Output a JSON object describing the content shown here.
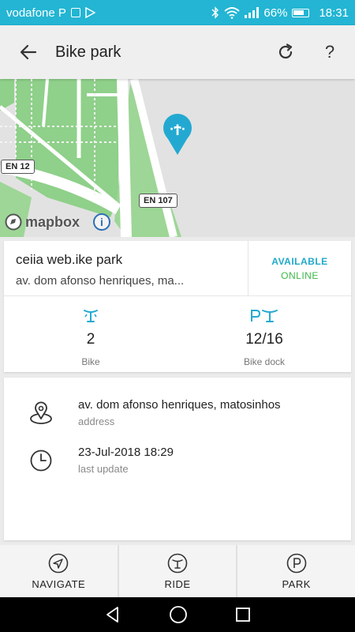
{
  "status_bar": {
    "carrier": "vodafone P",
    "battery": "66%",
    "time": "18:31"
  },
  "app_bar": {
    "title": "Bike park",
    "back_icon": "arrow-left-icon",
    "refresh_icon": "refresh-icon",
    "help_label": "?"
  },
  "map": {
    "attribution": "mapbox",
    "info_label": "i",
    "road_labels": [
      "EN 12",
      "EN 107"
    ],
    "marker_color": "#23a9d1"
  },
  "park": {
    "name": "ceiia web.ike park",
    "address_short": "av. dom afonso henriques, ma...",
    "status": "AVAILABLE",
    "connection": "ONLINE"
  },
  "stats": [
    {
      "icon": "bike-icon",
      "value": "2",
      "label": "Bike"
    },
    {
      "icon": "bike-dock-icon",
      "value": "12/16",
      "label": "Bike dock"
    }
  ],
  "details": {
    "address_value": "av. dom afonso henriques, matosinhos",
    "address_label": "address",
    "update_value": "23-Jul-2018 18:29",
    "update_label": "last update"
  },
  "bottom_nav": [
    {
      "icon": "navigate-icon",
      "label": "NAVIGATE"
    },
    {
      "icon": "ride-icon",
      "label": "RIDE"
    },
    {
      "icon": "park-icon",
      "label": "PARK"
    }
  ],
  "colors": {
    "accent": "#23b5d3",
    "available": "#1fa9c9",
    "online": "#3db94a",
    "park_green": "#8fd08a"
  }
}
